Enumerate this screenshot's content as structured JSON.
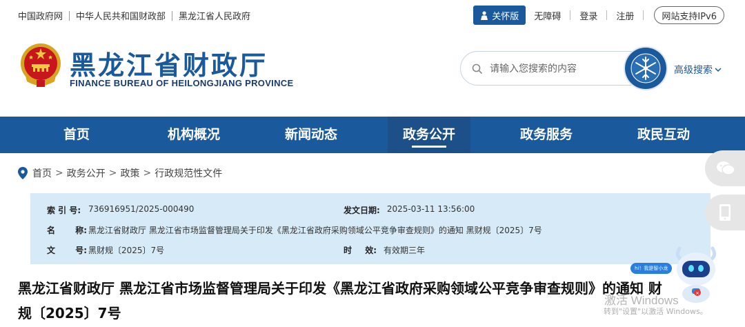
{
  "top": {
    "links": [
      "中国政府网",
      "中华人民共和国财政部",
      "黑龙江省人民政府"
    ],
    "care_label": "关怀版",
    "accessibility_label": "无障碍",
    "login_label": "登录",
    "register_label": "注册",
    "ipv6_label": "网站支持IPv6"
  },
  "header": {
    "title": "黑龙江省财政厅",
    "subtitle": "FINANCE BUREAU OF HEILONGJIANG PROVINCE",
    "search_placeholder": "请输入您搜索的内容",
    "advanced_search_label": "高级搜索"
  },
  "nav": {
    "items": [
      "首页",
      "机构概况",
      "新闻动态",
      "政务公开",
      "政务服务",
      "政民互动"
    ],
    "active_index": 3
  },
  "breadcrumb": [
    "首页",
    "政务公开",
    "政策",
    "行政规范性文件"
  ],
  "info": {
    "index_label": "索 引 号:",
    "index_value": "736916951/2025-000490",
    "date_label": "发文日期:",
    "date_value": "2025-03-11 13:56:00",
    "name_label_1": "名",
    "name_label_2": "称:",
    "name_value": "黑龙江省财政厅 黑龙江省市场监督管理局关于印发《黑龙江省政府采购领域公平竞争审查规则》的通知 黑财规〔2025〕7号",
    "docno_label_1": "文",
    "docno_label_2": "号:",
    "docno_value": "黑财规〔2025〕7号",
    "validity_label_1": "时",
    "validity_label_2": "效:",
    "validity_value": "有效期三年"
  },
  "article": {
    "title_line1": "黑龙江省财政厅  黑龙江省市场监督管理局关于印发《黑龙江省政府采购领域公平竞争审查规则》的通知   财",
    "title_line2": "规〔2025〕7号"
  },
  "assistant": {
    "bubble": "hi！我是智小龙"
  },
  "os_watermark": {
    "line1": "激活 Windows",
    "line2": "转到\"设置\"以激活 Windows。"
  },
  "colors": {
    "brand_blue": "#1a5a9c",
    "info_bg": "#d7eaf7"
  }
}
